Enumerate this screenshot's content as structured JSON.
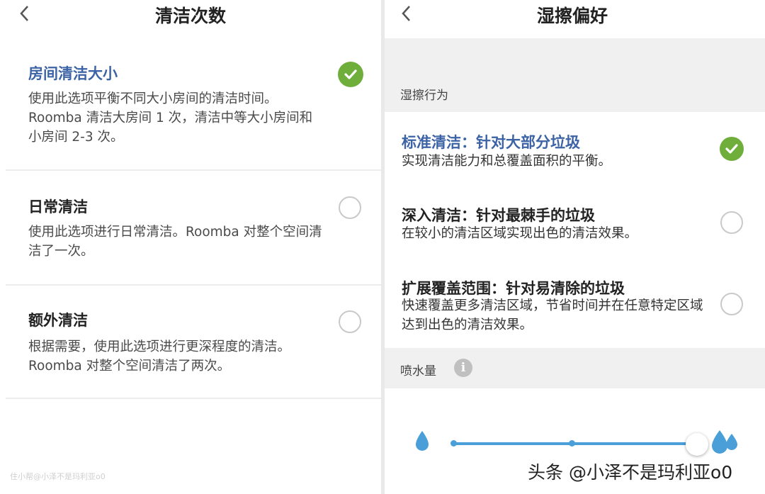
{
  "left": {
    "back_icon": "chevron-left-icon",
    "title": "清洁次数",
    "options": [
      {
        "title": "房间清洁大小",
        "desc": "使用此选项平衡不同大小房间的清洁时间。Roomba 清洁大房间 1 次，清洁中等大小房间和小房间 2-3 次。",
        "selected": true
      },
      {
        "title": "日常清洁",
        "desc": "使用此选项进行日常清洁。Roomba 对整个空间清洁了一次。",
        "selected": false
      },
      {
        "title": "额外清洁",
        "desc": "根据需要，使用此选项进行更深程度的清洁。Roomba 对整个空间清洁了两次。",
        "selected": false
      }
    ]
  },
  "right": {
    "back_icon": "chevron-left-icon",
    "title": "湿擦偏好",
    "section_behavior": "湿擦行为",
    "options": [
      {
        "title": "标准清洁：针对大部分垃圾",
        "desc": "实现清洁能力和总覆盖面积的平衡。",
        "selected": true
      },
      {
        "title": "深入清洁：针对最棘手的垃圾",
        "desc": "在较小的清洁区域实现出色的清洁效果。",
        "selected": false
      },
      {
        "title": "扩展覆盖范围：针对易清除的垃圾",
        "desc": "快速覆盖更多清洁区域，节省时间并在任意特定区域达到出色的清洁效果。",
        "selected": false
      }
    ],
    "section_spray": "喷水量",
    "info_icon": "info-icon",
    "spray_level": 1.0
  },
  "colors": {
    "accent": "#3b63a6",
    "check": "#6fae3a",
    "slider": "#4a9fd8"
  },
  "watermark_left": "住小帮@小泽不是玛利亚o0",
  "watermark_right": "头条 @小泽不是玛利亚o0"
}
